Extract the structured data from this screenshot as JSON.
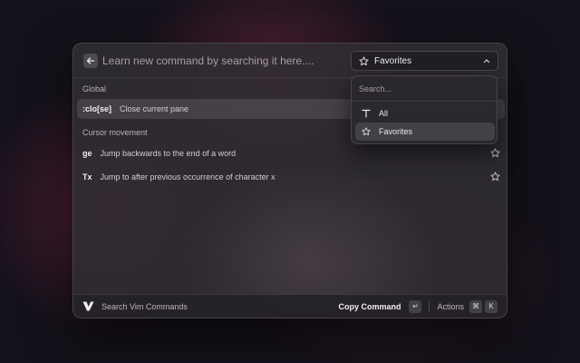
{
  "header": {
    "search_placeholder": "Learn new command by searching it here....",
    "filter_selected": "Favorites"
  },
  "sections": [
    {
      "label": "Global"
    },
    {
      "label": "Cursor movement"
    }
  ],
  "commands": [
    {
      "key": ":clo[se]",
      "desc": "Close current pane"
    },
    {
      "key": "ge",
      "desc": "Jump backwards to the end of a word"
    },
    {
      "key": "Tx",
      "desc": "Jump to after previous occurrence of character x"
    }
  ],
  "dropdown": {
    "search_placeholder": "Search...",
    "options": [
      {
        "label": "All",
        "icon": "text-icon"
      },
      {
        "label": "Favorites",
        "icon": "star-icon"
      }
    ]
  },
  "footer": {
    "app_name": "Search Vim Commands",
    "primary_action": "Copy Command",
    "primary_key": "↵",
    "secondary_action": "Actions",
    "secondary_keys": [
      "⌘",
      "K"
    ]
  },
  "colors": {
    "background": "#15111a",
    "window": "#302c32",
    "accent": "#8c3250"
  }
}
